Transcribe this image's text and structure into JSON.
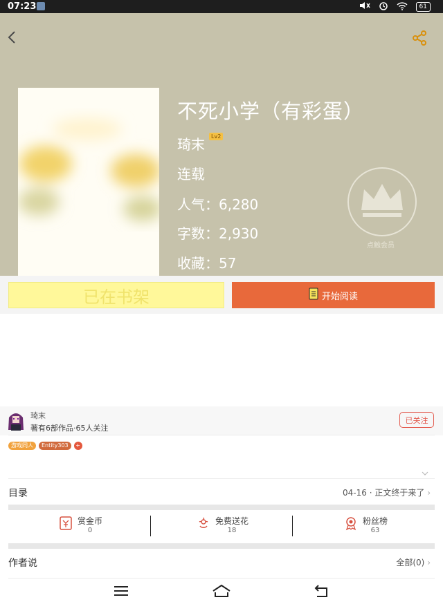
{
  "status_bar": {
    "time": "07:23",
    "battery": "61"
  },
  "book": {
    "title": "不死小学（有彩蛋）",
    "author": "琦末",
    "author_level": "Lv2",
    "status": "连载",
    "popularity": "人气：6,280",
    "word_count": "字数：2,930",
    "favorites": "收藏：57"
  },
  "membership_badge": {
    "label": "点触会员"
  },
  "actions": {
    "shelf_label": "已在书架",
    "read_label": "开始阅读"
  },
  "author_card": {
    "name": "琦末",
    "meta": "著有6部作品·65人关注",
    "follow_label": "已关注",
    "tags": [
      "游戏同人",
      "Entity303"
    ],
    "add_tag": "+"
  },
  "catalog": {
    "label": "目录",
    "latest": "04-16 · 正文终于来了"
  },
  "stats": {
    "reward": {
      "label": "赏金币",
      "value": "0"
    },
    "flowers": {
      "label": "免费送花",
      "value": "18"
    },
    "fans": {
      "label": "粉丝榜",
      "value": "63"
    }
  },
  "author_says": {
    "label": "作者说",
    "all_label": "全部(0)"
  },
  "colors": {
    "header_bg": "#c6c2ab",
    "accent": "#e8693b",
    "shelf_btn": "#fff89a",
    "follow": "#e35b4f"
  }
}
